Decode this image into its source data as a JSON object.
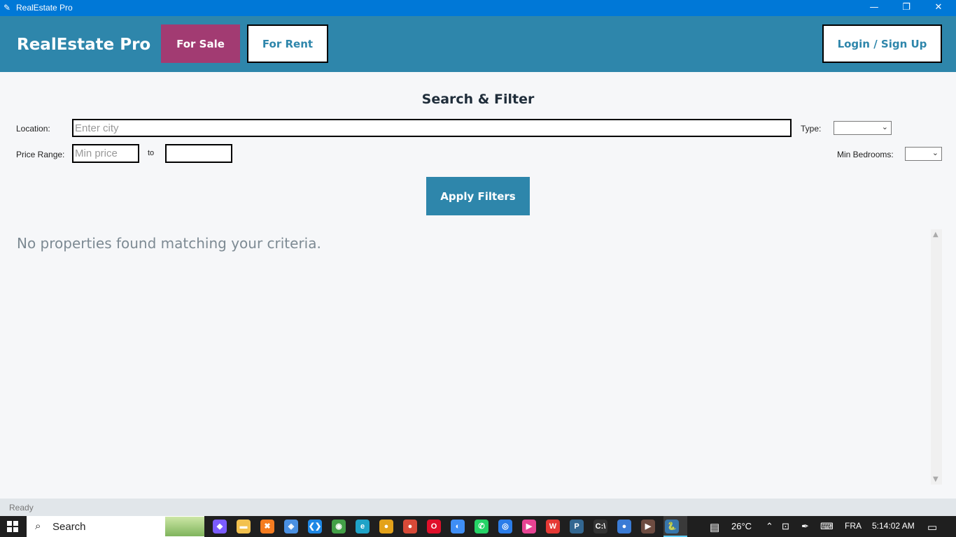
{
  "window": {
    "title": "RealEstate Pro",
    "controls": {
      "minimize": "—",
      "maximize": "❐",
      "close": "✕"
    }
  },
  "header": {
    "brand": "RealEstate Pro",
    "for_sale": "For Sale",
    "for_rent": "For Rent",
    "login": "Login / Sign Up"
  },
  "filters": {
    "title": "Search & Filter",
    "location_label": "Location:",
    "location_placeholder": "Enter city",
    "location_value": "",
    "type_label": "Type:",
    "type_value": "",
    "price_label": "Price Range:",
    "min_price_placeholder": "Min price",
    "to_label": "to",
    "max_price_value": "",
    "bedrooms_label": "Min Bedrooms:",
    "bedrooms_value": "",
    "apply_label": "Apply Filters"
  },
  "results": {
    "empty_message": "No properties found matching your criteria."
  },
  "status": {
    "text": "Ready"
  },
  "taskbar": {
    "search_label": "Search",
    "apps": [
      {
        "name": "copilot",
        "glyph": "◆",
        "color": "#7b5cff"
      },
      {
        "name": "file-explorer",
        "glyph": "▬",
        "color": "#f2c14e"
      },
      {
        "name": "xampp",
        "glyph": "✖",
        "color": "#f57c20"
      },
      {
        "name": "app",
        "glyph": "◈",
        "color": "#4a90e2"
      },
      {
        "name": "vscode",
        "glyph": "❮❯",
        "color": "#1e88e5"
      },
      {
        "name": "app",
        "glyph": "◉",
        "color": "#43a047"
      },
      {
        "name": "edge",
        "glyph": "e",
        "color": "#1fa3c7"
      },
      {
        "name": "chrome",
        "glyph": "●",
        "color": "#e3a21a"
      },
      {
        "name": "chrome",
        "glyph": "●",
        "color": "#d84a38"
      },
      {
        "name": "opera",
        "glyph": "O",
        "color": "#e0102a"
      },
      {
        "name": "app",
        "glyph": "◐",
        "color": "#3f8ef5"
      },
      {
        "name": "whatsapp",
        "glyph": "✆",
        "color": "#25d366"
      },
      {
        "name": "app",
        "glyph": "◎",
        "color": "#2b7de9"
      },
      {
        "name": "app",
        "glyph": "▶",
        "color": "#e84393"
      },
      {
        "name": "wps",
        "glyph": "W",
        "color": "#e53935"
      },
      {
        "name": "postgres",
        "glyph": "P",
        "color": "#336791"
      },
      {
        "name": "terminal",
        "glyph": "C:\\",
        "color": "#333333"
      },
      {
        "name": "chrome",
        "glyph": "●",
        "color": "#3a7bd5"
      },
      {
        "name": "media",
        "glyph": "▶",
        "color": "#6d4c41"
      },
      {
        "name": "python",
        "glyph": "🐍",
        "color": "#3776ab"
      }
    ],
    "weather": "26°C",
    "language": "FRA",
    "time": "5:14:02 AM"
  }
}
